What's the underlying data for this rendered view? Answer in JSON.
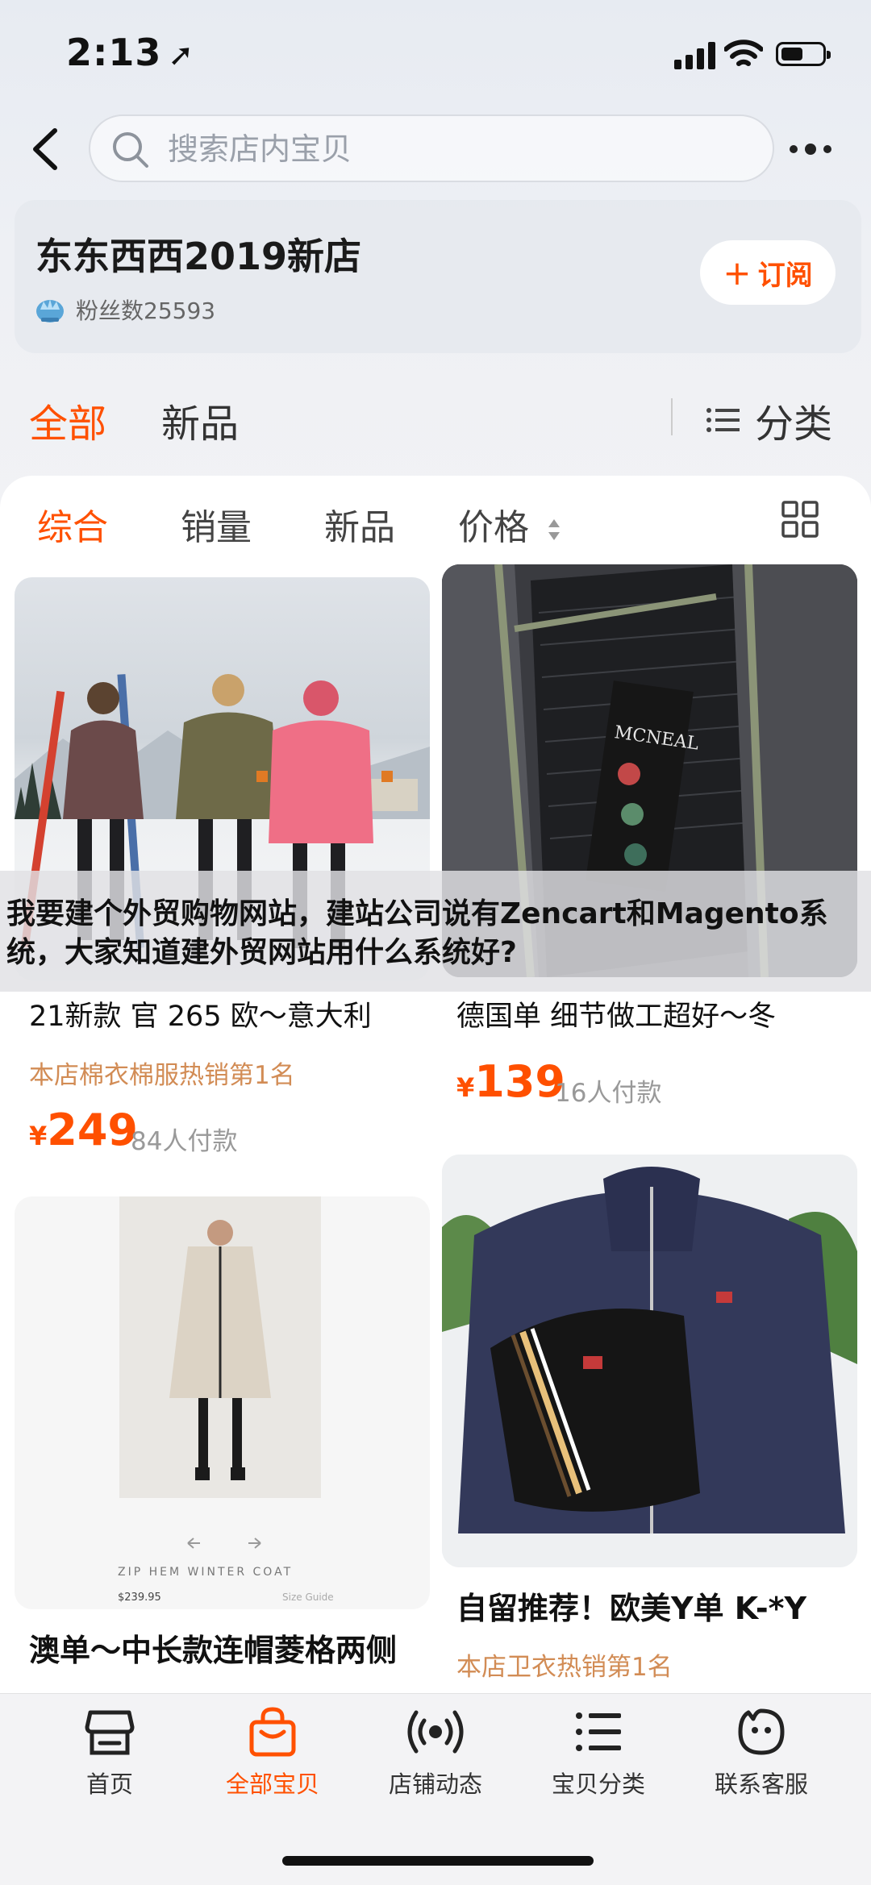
{
  "status_bar": {
    "time": "2:13",
    "location_arrow": "➚"
  },
  "search": {
    "placeholder": "搜索店内宝贝"
  },
  "shop": {
    "name": "东东西西2019新店",
    "fans": "粉丝数25593",
    "subscribe_label": "订阅",
    "subscribe_icon": "plus-icon"
  },
  "tabs": {
    "all": "全部",
    "new": "新品",
    "category": "分类"
  },
  "sort": {
    "overall": "综合",
    "sales": "销量",
    "new": "新品",
    "price": "价格"
  },
  "overlay": {
    "text": "我要建个外贸购物网站，建站公司说有Zencart和Magento系统，大家知道建外贸网站用什么系统好?"
  },
  "products": [
    {
      "title": "21新款 官 265 欧～意大利",
      "tag": "本店棉衣棉服热销第1名",
      "currency": "¥",
      "price": "249",
      "sold": "84人付款"
    },
    {
      "title": "德国单 细节做工超好～冬",
      "tag": "",
      "currency": "¥",
      "price": "139",
      "sold": "16人付款"
    },
    {
      "title": "澳单～中长款连帽菱格两侧",
      "tag": "",
      "currency": "¥",
      "price": "",
      "sold": "",
      "image_caption": "ZIP HEM WINTER COAT",
      "image_price": "$239.95",
      "image_size_guide": "Size Guide"
    },
    {
      "title": "自留推荐！欧美Y单 K-*Y",
      "tag": "本店卫衣热销第1名",
      "currency": "¥",
      "price": "",
      "sold": ""
    }
  ],
  "label_brand": "MCNEAL",
  "bottom_nav": [
    {
      "label": "首页",
      "icon": "shop-home-icon"
    },
    {
      "label": "全部宝贝",
      "icon": "shopping-bag-icon"
    },
    {
      "label": "店铺动态",
      "icon": "broadcast-icon"
    },
    {
      "label": "宝贝分类",
      "icon": "list-icon"
    },
    {
      "label": "联系客服",
      "icon": "chat-face-icon"
    }
  ],
  "colors": {
    "accent": "#ff5000",
    "tag": "#d28c55"
  }
}
